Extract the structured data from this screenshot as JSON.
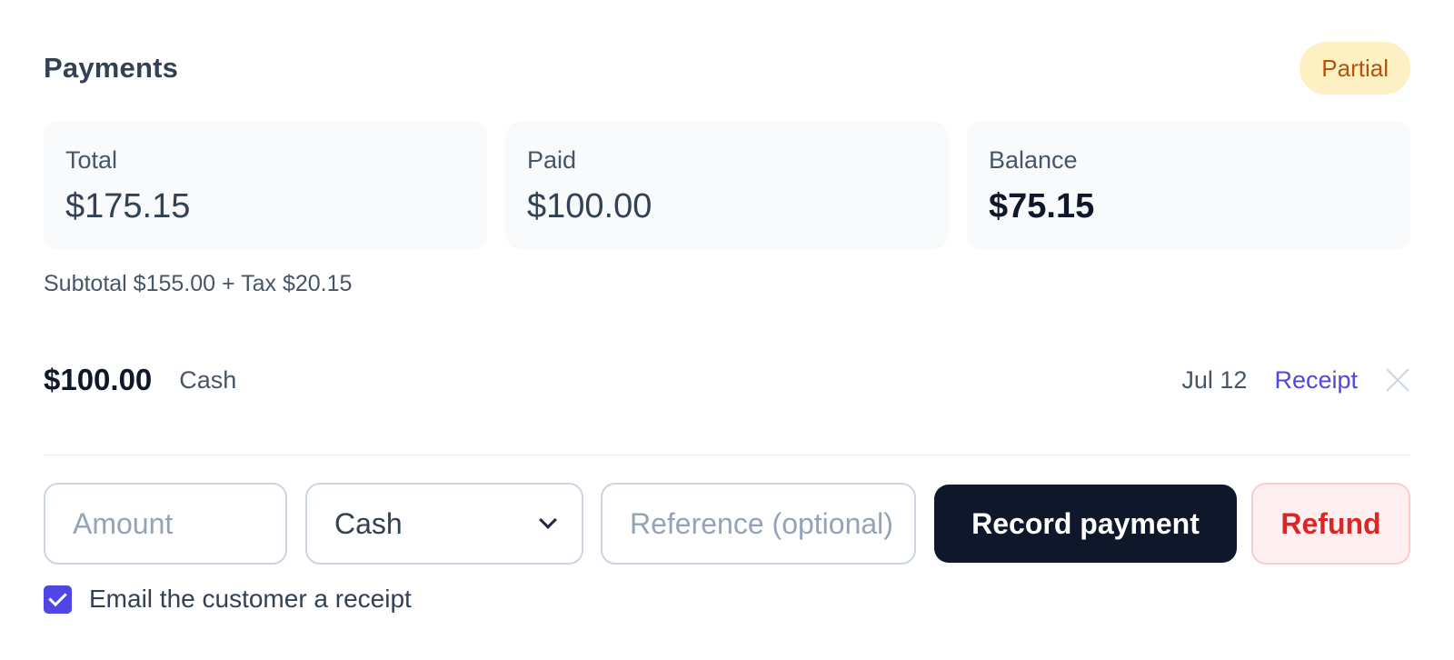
{
  "header": {
    "title": "Payments",
    "status_badge": "Partial"
  },
  "summary": {
    "cards": [
      {
        "label": "Total",
        "value": "$175.15"
      },
      {
        "label": "Paid",
        "value": "$100.00"
      },
      {
        "label": "Balance",
        "value": "$75.15"
      }
    ],
    "breakdown": "Subtotal $155.00 + Tax $20.15"
  },
  "payments": [
    {
      "amount": "$100.00",
      "method": "Cash",
      "date": "Jul 12",
      "receipt_label": "Receipt",
      "remove_icon": "close-icon"
    }
  ],
  "form": {
    "amount_placeholder": "Amount",
    "method_selected": "Cash",
    "reference_placeholder": "Reference (optional)",
    "record_button": "Record payment",
    "refund_button": "Refund",
    "email_receipt_checked": true,
    "email_receipt_label": "Email the customer a receipt"
  },
  "colors": {
    "badge_bg": "#fdf0c2",
    "badge_text": "#b45309",
    "link": "#4f46e5",
    "primary_button": "#0f172a",
    "refund_text": "#dc2626",
    "checkbox": "#4f46e5"
  }
}
